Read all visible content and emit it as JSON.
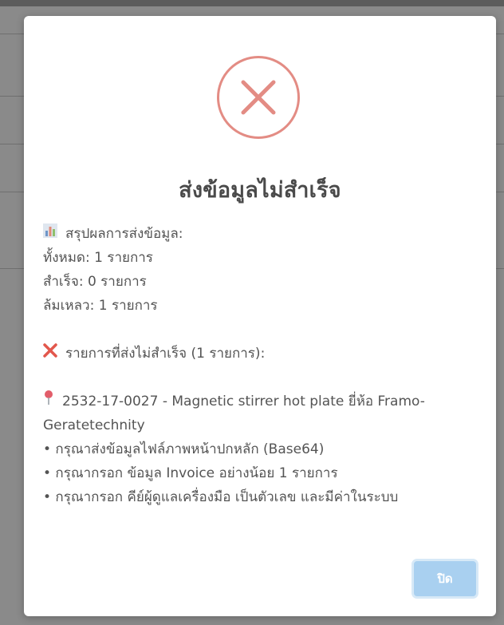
{
  "dialog": {
    "icon": "error-x-icon",
    "title": "ส่งข้อมูลไม่สำเร็จ",
    "summary": {
      "heading_icon": "bar-chart-icon",
      "heading": "สรุปผลการส่งข้อมูล:",
      "total": "ทั้งหมด: 1 รายการ",
      "success": "สำเร็จ: 0 รายการ",
      "failed": "ล้มเหลว: 1 รายการ"
    },
    "failed_section": {
      "heading_icon": "red-x-icon",
      "heading": "รายการที่ส่งไม่สำเร็จ (1 รายการ):"
    },
    "item": {
      "pin_icon": "pin-icon",
      "title": "2532-17-0027 - Magnetic stirrer hot plate ยี่ห้อ Framo-Geratetechnity",
      "errors": [
        "• กรุณาส่งข้อมูลไฟล์ภาพหน้าปกหลัก (Base64)",
        "• กรุณากรอก ข้อมูล Invoice อย่างน้อย 1 รายการ",
        "• กรุณากรอก คีย์ผู้ดูแลเครื่องมือ เป็นตัวเลข และมีค่าในระบบ"
      ]
    },
    "close_label": "ปิด"
  },
  "colors": {
    "error_red": "#e38c84",
    "button_bg": "#a9d0f0",
    "overlay": "#8a8a8a"
  }
}
